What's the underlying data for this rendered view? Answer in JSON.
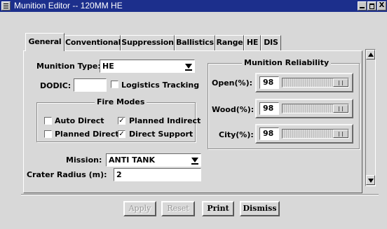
{
  "window": {
    "title": "Munition Editor -- 120MM HE",
    "controls": {
      "minimize": "_",
      "maximize": "□",
      "close": "X"
    }
  },
  "tabs": [
    {
      "label": "General",
      "active": true
    },
    {
      "label": "Conventional",
      "active": false
    },
    {
      "label": "Suppression",
      "active": false
    },
    {
      "label": "Ballistics",
      "active": false
    },
    {
      "label": "Range",
      "active": false
    },
    {
      "label": "HE",
      "active": false
    },
    {
      "label": "DIS",
      "active": false
    }
  ],
  "general": {
    "munition_type_label": "Munition Type:",
    "munition_type_value": "HE",
    "dodic_label": "DODIC:",
    "dodic_value": "",
    "logistics_tracking": {
      "label": "Logistics Tracking",
      "checked": false
    },
    "fire_modes": {
      "title": "Fire Modes",
      "auto_direct": {
        "label": "Auto Direct",
        "checked": false
      },
      "planned_indirect": {
        "label": "Planned Indirect",
        "checked": true
      },
      "planned_direct": {
        "label": "Planned Direct",
        "checked": false
      },
      "direct_support": {
        "label": "Direct Support",
        "checked": true
      }
    },
    "mission_label": "Mission:",
    "mission_value": "ANTI TANK",
    "crater_radius_label": "Crater Radius (m):",
    "crater_radius_value": "2"
  },
  "reliability": {
    "title": "Munition Reliability",
    "rows": [
      {
        "label": "Open(%):",
        "value": "98"
      },
      {
        "label": "Wood(%):",
        "value": "98"
      },
      {
        "label": "City(%):",
        "value": "98"
      }
    ]
  },
  "buttons": {
    "apply": "Apply",
    "reset": "Reset",
    "print": "Print",
    "dismiss": "Dismiss"
  },
  "check_mark": "✓"
}
